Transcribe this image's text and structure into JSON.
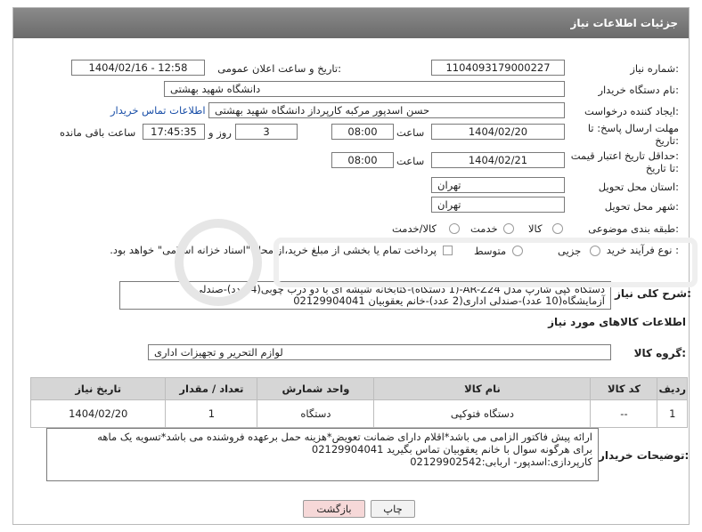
{
  "header": {
    "title": "جزئیات اطلاعات نیاز"
  },
  "fields": {
    "need_number": {
      "label": "شماره نیاز:",
      "value": "1104093179000227"
    },
    "announce_datetime": {
      "label": "تاریخ و ساعت اعلان عمومی:",
      "value": "1404/02/16 - 12:58"
    },
    "buyer_org": {
      "label": "نام دستگاه خریدار:",
      "value": "دانشگاه شهید بهشتی"
    },
    "creator": {
      "label": "ایجاد کننده درخواست:",
      "value": "حسن اسدپور مرکبه کارپرداز دانشگاه شهید بهشتی",
      "contact_link": "اطلاعات تماس خریدار"
    },
    "reply_deadline": {
      "label_line1": "مهلت ارسال پاسخ: تا",
      "label_line2": "تاریخ:",
      "date": "1404/02/20",
      "time_label": "ساعت",
      "time": "08:00",
      "days": "3",
      "days_label": "روز و",
      "remaining": "17:45:35",
      "remaining_label": "ساعت باقی مانده"
    },
    "price_validity": {
      "label_line1": "حداقل تاریخ اعتبار قیمت:",
      "label_line2": "تا تاریخ:",
      "date": "1404/02/21",
      "time_label": "ساعت",
      "time": "08:00"
    },
    "province": {
      "label": "استان محل تحویل:",
      "value": "تهران"
    },
    "city": {
      "label": "شهر محل تحویل:",
      "value": "تهران"
    },
    "category": {
      "label": "طبقه بندی موضوعی:",
      "options": [
        "کالا",
        "خدمت",
        "کالا/خدمت"
      ]
    },
    "purchase_type": {
      "label": "نوع فرآیند خرید :",
      "options": [
        "جزیی",
        "متوسط"
      ],
      "note": "پرداخت تمام یا بخشی از مبلغ خرید،از محل \"اسناد خزانه اسلامی\" خواهد بود."
    },
    "summary": {
      "label": "شرح کلی نیاز:",
      "line1": "دستگاه کپی شارپ مدل AR-Z24-(1 دستگاه)-کتابخانه شیشه ای با دو درب چوبی(4 عدد)-صندلی",
      "line2": "آزمایشگاه(10 عدد)-صندلی اداری(2 عدد)-خانم یعقوبیان 02129904041"
    }
  },
  "goods_section": {
    "title": "اطلاعات کالاهای مورد نیاز",
    "group_label": "گروه کالا:",
    "group_value": "لوازم التحریر و تجهیزات اداری",
    "columns": [
      "ردیف",
      "کد کالا",
      "نام کالا",
      "واحد شمارش",
      "تعداد / مقدار",
      "تاریخ نیاز"
    ],
    "rows": [
      {
        "row": "1",
        "code": "--",
        "name": "دستگاه فتوکپی",
        "unit": "دستگاه",
        "qty": "1",
        "date": "1404/02/20"
      }
    ]
  },
  "buyer_notes": {
    "label": "توضیحات خریدار:",
    "line1": "ارائه پیش فاکتور الزامی می باشد*اقلام دارای ضمانت تعویض*هزینه حمل برعهده فروشنده می باشد*تسویه یک ماهه",
    "line2": "برای هرگونه سوال با خانم یعقوبیان تماس بگیرید 02129904041",
    "line3": "کارپردازی:اسدپور- اربابی:02129902542"
  },
  "buttons": {
    "print": "چاپ",
    "back": "بازگشت"
  },
  "colors": {
    "header_bg": "#777777",
    "link": "#1a4fa8",
    "back_button_bg": "#f6d8d8"
  }
}
